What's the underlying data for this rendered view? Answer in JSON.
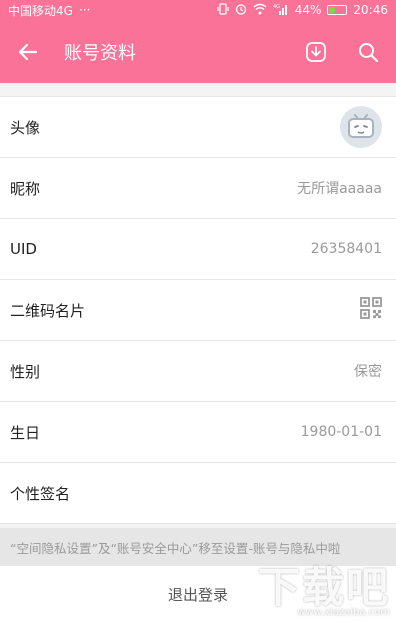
{
  "status_bar": {
    "carrier": "中国移动4G",
    "dots": "···",
    "network": "4G",
    "battery_text": "44%",
    "battery_level": 0.44,
    "time": "20:46"
  },
  "app_bar": {
    "title": "账号资料",
    "icons": [
      "back-arrow-icon",
      "download-icon",
      "search-icon"
    ]
  },
  "profile_rows": [
    {
      "label": "头像",
      "value": ""
    },
    {
      "label": "昵称",
      "value": "无所谓aaaaa"
    },
    {
      "label": "UID",
      "value": "26358401"
    },
    {
      "label": "二维码名片",
      "value": ""
    },
    {
      "label": "性别",
      "value": "保密"
    },
    {
      "label": "生日",
      "value": "1980-01-01"
    },
    {
      "label": "个性签名",
      "value": ""
    }
  ],
  "notice": "“空间隐私设置”及“账号安全中心”移至设置-账号与隐私中啦",
  "logout_label": "退出登录",
  "watermark": {
    "main": "下载吧",
    "sub": "www.xiazaiba.com"
  },
  "colors": {
    "accent": "#fb7299",
    "background": "#f4f4f4"
  }
}
